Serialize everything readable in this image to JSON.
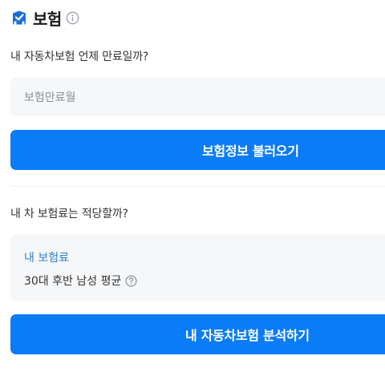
{
  "header": {
    "title": "보험"
  },
  "section1": {
    "question": "내 자동차보험 언제 만료일까?",
    "input_placeholder": "보험만료월",
    "button_label": "보험정보 불러오기"
  },
  "section2": {
    "question": "내 차 보험료는 적당할까?",
    "card_label": "내 보험료",
    "card_value": "30대 후반 남성 평균",
    "button_label": "내 자동차보험 분석하기"
  },
  "colors": {
    "primary": "#0a7cf5",
    "link": "#2e7ed4",
    "surface": "#f6f7f9"
  },
  "icons": {
    "logo": "car-insurance-check-icon",
    "info": "info-circle-icon",
    "help": "question-circle-icon"
  }
}
